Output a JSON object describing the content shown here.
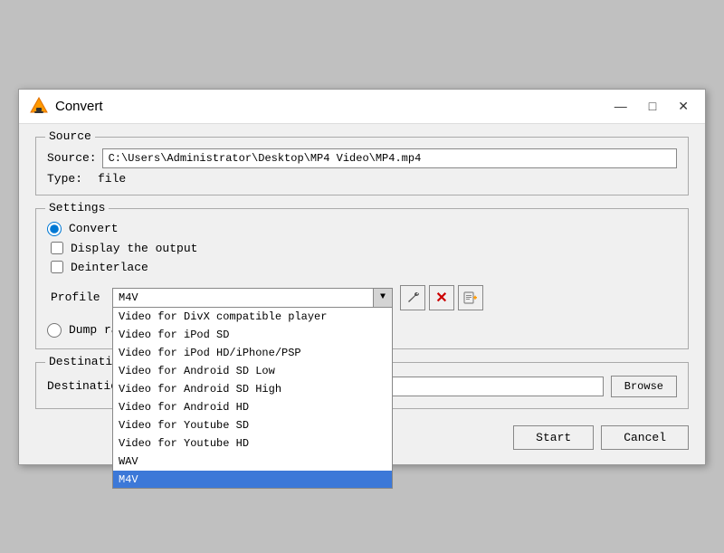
{
  "window": {
    "title": "Convert",
    "icon": "vlc-icon"
  },
  "title_controls": {
    "minimize": "—",
    "maximize": "□",
    "close": "✕"
  },
  "source_group": {
    "label": "Source",
    "source_label": "Source:",
    "source_value": "C:\\Users\\Administrator\\Desktop\\MP4 Video\\MP4.mp4",
    "type_label": "Type:",
    "type_value": "file"
  },
  "settings_group": {
    "label": "Settings",
    "convert_radio_label": "Convert",
    "display_checkbox_label": "Display the output",
    "deinterlace_checkbox_label": "Deinterlace",
    "profile_label": "Profile",
    "profile_value": "M4V",
    "dump_radio_label": "Dump raw input"
  },
  "profile_dropdown": {
    "items": [
      {
        "label": "Video for DivX compatible player",
        "selected": false
      },
      {
        "label": "Video for iPod SD",
        "selected": false
      },
      {
        "label": "Video for iPod HD/iPhone/PSP",
        "selected": false
      },
      {
        "label": "Video for Android SD Low",
        "selected": false
      },
      {
        "label": "Video for Android SD High",
        "selected": false
      },
      {
        "label": "Video for Android HD",
        "selected": false
      },
      {
        "label": "Video for Youtube SD",
        "selected": false
      },
      {
        "label": "Video for Youtube HD",
        "selected": false
      },
      {
        "label": "WAV",
        "selected": false
      },
      {
        "label": "M4V",
        "selected": true
      }
    ]
  },
  "destination_group": {
    "label": "Destination",
    "dest_file_label": "Destination file:",
    "dest_value": "",
    "browse_label": "Browse"
  },
  "footer": {
    "start_label": "Start",
    "cancel_label": "Cancel"
  }
}
